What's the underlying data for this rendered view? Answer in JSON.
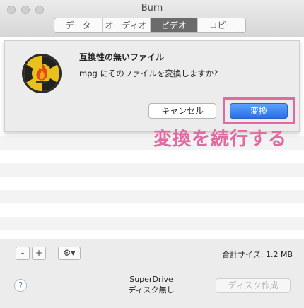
{
  "window": {
    "title": "Burn",
    "tabs": [
      {
        "label": "データ",
        "active": false
      },
      {
        "label": "オーディオ",
        "active": false
      },
      {
        "label": "ビデオ",
        "active": true
      },
      {
        "label": "コピー",
        "active": false
      }
    ]
  },
  "dialog": {
    "title": "互換性の無いファイル",
    "message": "mpg にそのファイルを変換しますか?",
    "cancel_label": "キャンセル",
    "convert_label": "変換",
    "accent_color": "#2b6fe0"
  },
  "annotation": {
    "text": "変換を続行する",
    "color": "#e16aa0"
  },
  "toolbar": {
    "remove_label": "-",
    "add_label": "+",
    "gear_icon": "gear-icon",
    "total_size": "合計サイズ: 1.2 MB"
  },
  "footer": {
    "help_label": "?",
    "drive_name": "SuperDrive",
    "drive_status": "ディスク無し",
    "burn_label": "ディスク作成"
  }
}
